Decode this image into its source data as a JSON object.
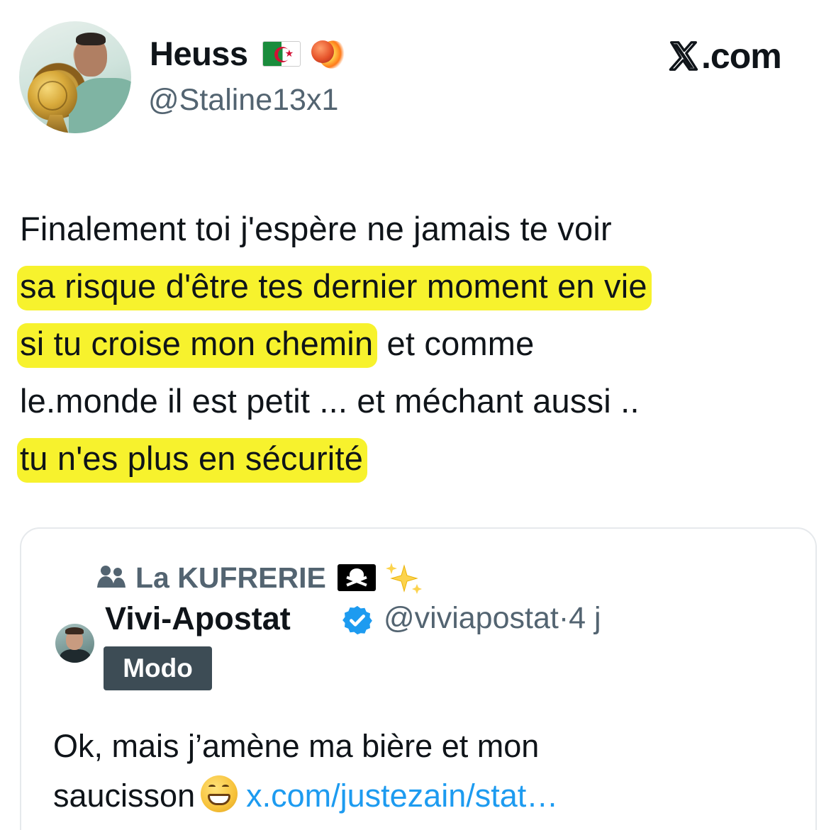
{
  "author": {
    "display_name": "Heuss",
    "handle": "@Staline13x1",
    "name_emojis": [
      "algeria-flag-icon",
      "comet-ball-icon"
    ]
  },
  "source_label": "X.com",
  "tweet": {
    "lines": [
      {
        "text": "Finalement toi j'espère ne jamais te voir",
        "highlighted": ""
      },
      {
        "text": "",
        "highlighted": "sa risque d'être tes dernier moment en vie"
      },
      {
        "text": " et comme",
        "highlighted": "si tu croise mon chemin"
      },
      {
        "text": "le.monde il est petit ... et méchant aussi ..",
        "highlighted": ""
      },
      {
        "text": "",
        "highlighted": "tu n'es plus en sécurité"
      }
    ]
  },
  "quoted_tweet": {
    "community": "La KUFRERIE",
    "community_emojis": [
      "pirate-flag-icon",
      "sparkles-icon"
    ],
    "display_name": "Vivi-Apostat",
    "handle": "@viviapostat",
    "separator": "·",
    "time_ago": "4 j",
    "badge": "Modo",
    "text_line1": "Ok, mais j’amène ma bière et mon",
    "text_line2": "saucisson",
    "link": "x.com/justezain/stat…"
  },
  "colors": {
    "text": "#0f1419",
    "secondary": "#536471",
    "highlight": "#f7f22d",
    "link": "#1d9bf0",
    "verified": "#1d9bf0",
    "badge_bg": "#3d4c55",
    "card_border": "#e6e9ec"
  }
}
